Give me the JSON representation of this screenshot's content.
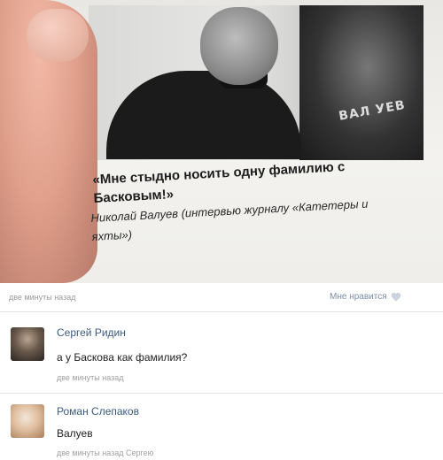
{
  "post": {
    "quote": "«Мне стыдно носить одну фамилию с Басковым!»",
    "attribution": "Николай Валуев (интервью журналу «Катетеры и яхты»)",
    "poster_text": "ВАЛ УЕВ",
    "time": "две минуты назад",
    "like_label": "Мне нравится"
  },
  "comments": [
    {
      "author": "Сергей Ридин",
      "text": "а у Баскова как фамилия?",
      "time": "две минуты назад"
    },
    {
      "author": "Роман Слепаков",
      "text": "Валуев",
      "time": "две минуты назад",
      "reply_to": "Сергею"
    }
  ],
  "colors": {
    "link": "#3b5a82",
    "meta": "#9a9a9a",
    "like": "#7c8da6"
  }
}
